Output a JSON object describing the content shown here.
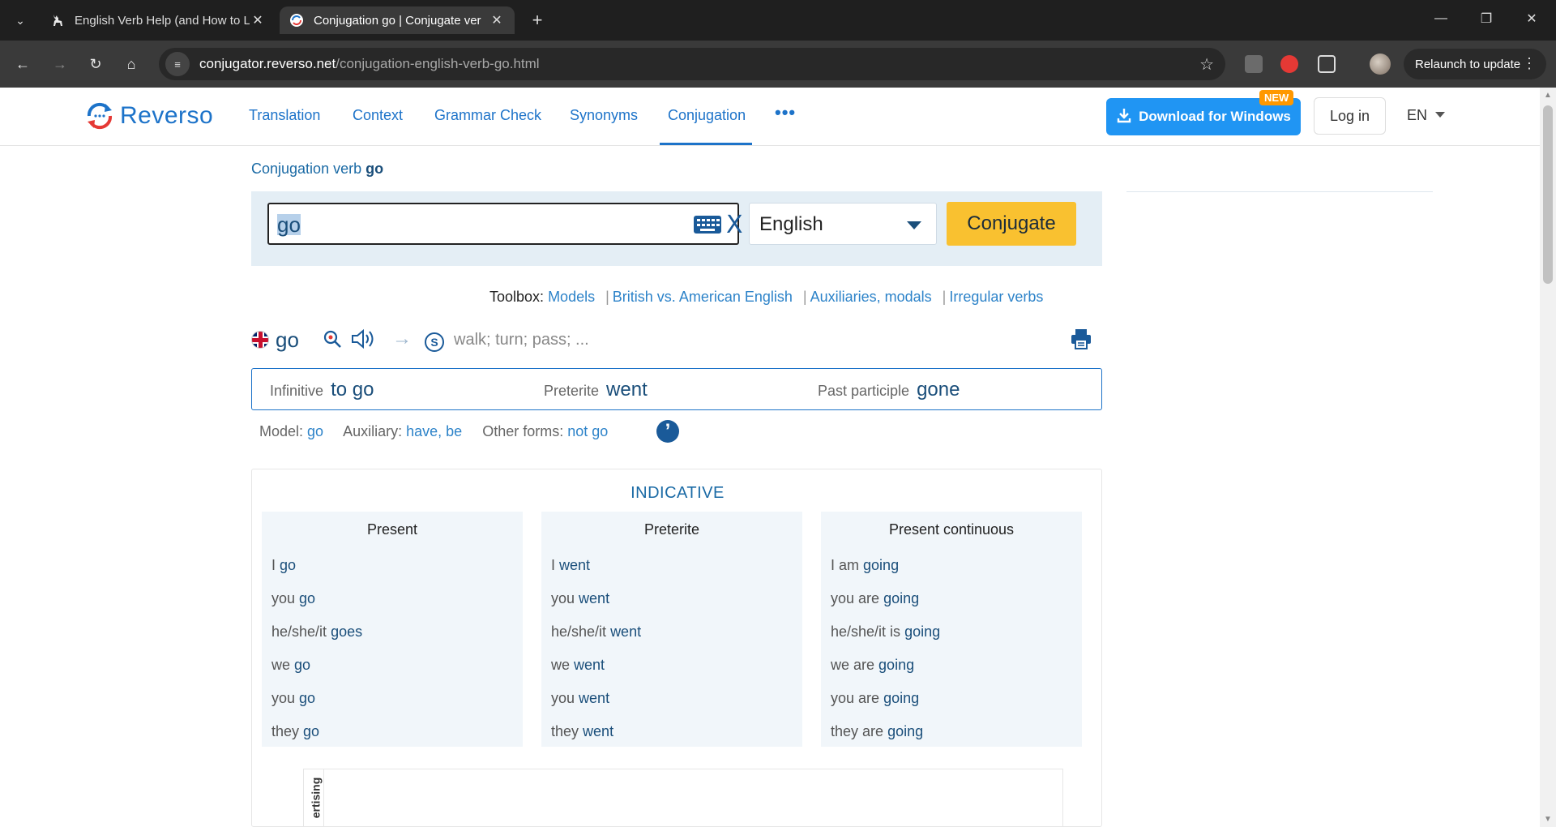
{
  "browser": {
    "tabs": [
      {
        "title": "English Verb Help (and How to L",
        "active": false
      },
      {
        "title": "Conjugation go | Conjugate ver",
        "active": true
      }
    ],
    "url_host": "conjugator.reverso.net",
    "url_path": "/conjugation-english-verb-go.html",
    "relaunch_label": "Relaunch to update"
  },
  "header": {
    "logo_text": "Reverso",
    "nav": [
      "Translation",
      "Context",
      "Grammar Check",
      "Synonyms",
      "Conjugation"
    ],
    "more": "•••",
    "download_label": "Download for Windows",
    "new_badge": "NEW",
    "login_label": "Log in",
    "lang": "EN"
  },
  "breadcrumb": {
    "prefix": "Conjugation verb",
    "verb": "go"
  },
  "search": {
    "value": "go",
    "language": "English",
    "conjugate_label": "Conjugate"
  },
  "toolbox": {
    "label": "Toolbox:",
    "links": [
      "Models",
      "British vs. American English",
      "Auxiliaries, modals",
      "Irregular verbs"
    ]
  },
  "verb_line": {
    "verb": "go",
    "synonyms": "walk; turn; pass; ..."
  },
  "forms": {
    "infinitive_label": "Infinitive",
    "infinitive": "to go",
    "preterite_label": "Preterite",
    "preterite": "went",
    "participle_label": "Past participle",
    "participle": "gone"
  },
  "model_line": {
    "model_label": "Model:",
    "model": "go",
    "aux_label": "Auxiliary:",
    "aux": "have, be",
    "other_label": "Other forms:",
    "other": "not go"
  },
  "indicative": {
    "title": "INDICATIVE",
    "tenses": [
      {
        "name": "Present",
        "rows": [
          {
            "p": "I",
            "v": "go"
          },
          {
            "p": "you",
            "v": "go"
          },
          {
            "p": "he/she/it",
            "v": "goes"
          },
          {
            "p": "we",
            "v": "go"
          },
          {
            "p": "you",
            "v": "go"
          },
          {
            "p": "they",
            "v": "go"
          }
        ]
      },
      {
        "name": "Preterite",
        "rows": [
          {
            "p": "I",
            "v": "went"
          },
          {
            "p": "you",
            "v": "went"
          },
          {
            "p": "he/she/it",
            "v": "went"
          },
          {
            "p": "we",
            "v": "went"
          },
          {
            "p": "you",
            "v": "went"
          },
          {
            "p": "they",
            "v": "went"
          }
        ]
      },
      {
        "name": "Present continuous",
        "rows": [
          {
            "p": "I am",
            "v": "going"
          },
          {
            "p": "you are",
            "v": "going"
          },
          {
            "p": "he/she/it is",
            "v": "going"
          },
          {
            "p": "we are",
            "v": "going"
          },
          {
            "p": "you are",
            "v": "going"
          },
          {
            "p": "they are",
            "v": "going"
          }
        ]
      }
    ]
  },
  "ad": {
    "label": "ertising"
  }
}
